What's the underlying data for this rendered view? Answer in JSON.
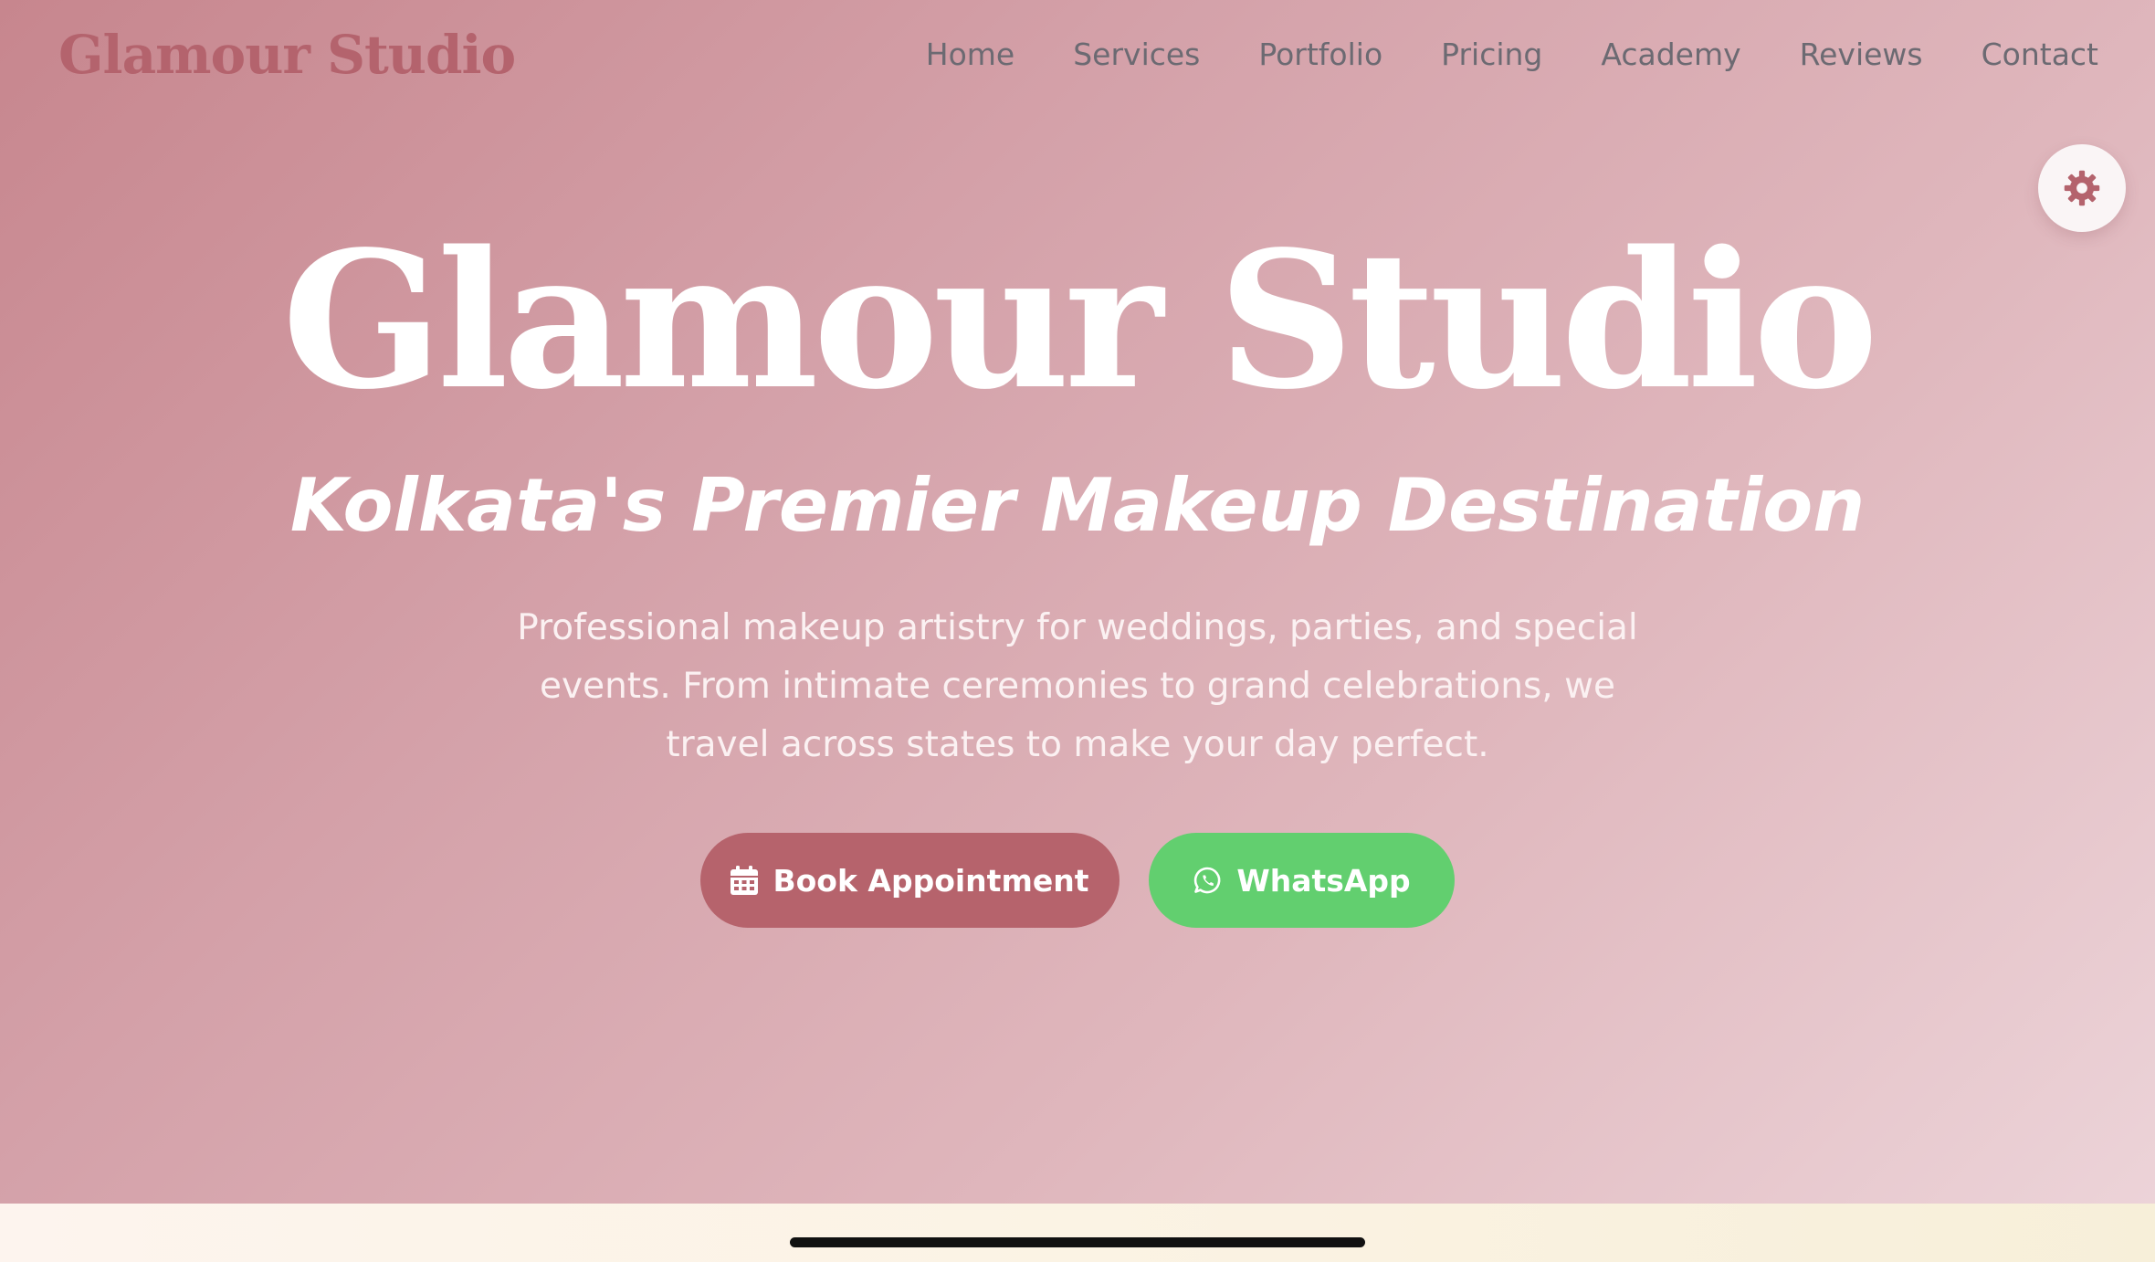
{
  "header": {
    "brand": "Glamour Studio",
    "nav": [
      "Home",
      "Services",
      "Portfolio",
      "Pricing",
      "Academy",
      "Reviews",
      "Contact"
    ]
  },
  "settings": {
    "icon": "gear-icon"
  },
  "hero": {
    "title": "Glamour Studio",
    "subtitle": "Kolkata's Premier Makeup Destination",
    "description": "Professional makeup artistry for weddings, parties, and special events. From intimate ceremonies to grand celebrations, we travel across states to make your day perfect.",
    "book_label": "Book Appointment",
    "book_icon": "calendar-icon",
    "whatsapp_label": "WhatsApp",
    "whatsapp_icon": "whatsapp-icon"
  },
  "colors": {
    "brand": "#b4636d",
    "book_button": "#b6636c",
    "whatsapp_button": "#62cf6f"
  }
}
